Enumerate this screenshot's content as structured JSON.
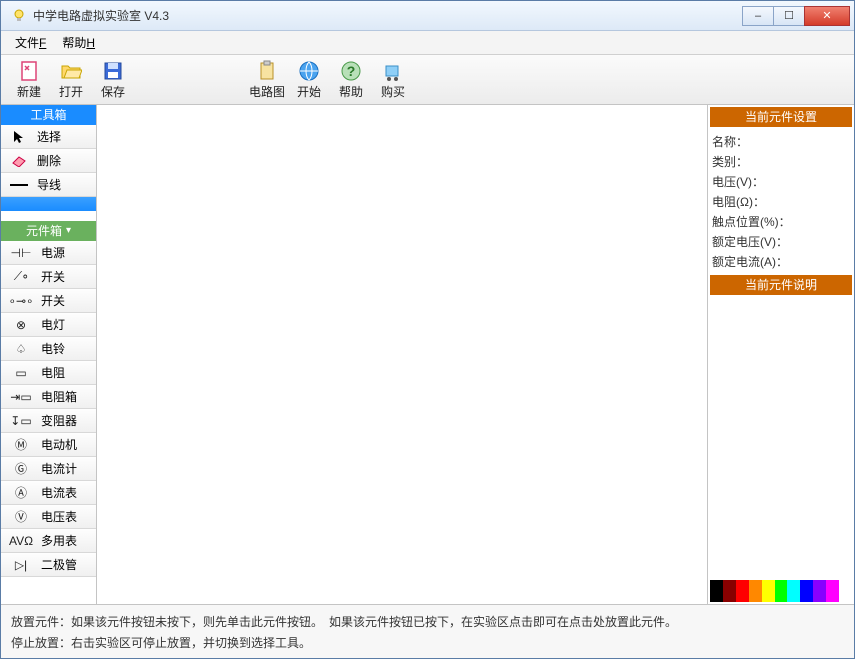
{
  "app": {
    "title": "中学电路虚拟实验室 V4.3"
  },
  "window_controls": {
    "minimize": "–",
    "maximize": "☐",
    "close": "✕"
  },
  "menubar": {
    "file": "文件",
    "file_key": "F",
    "help": "帮助",
    "help_key": "H"
  },
  "toolbar": {
    "new": "新建",
    "open": "打开",
    "save": "保存",
    "circuit": "电路图",
    "start": "开始",
    "help": "帮助",
    "buy": "购买"
  },
  "left": {
    "toolbox_title": "工具箱",
    "select": "选择",
    "delete": "删除",
    "wire": "导线",
    "componentbox_title": "元件箱",
    "components": [
      {
        "sym": "⊣⊢",
        "label": "电源"
      },
      {
        "sym": "⟋∘",
        "label": "开关"
      },
      {
        "sym": "∘⊸∘",
        "label": "开关"
      },
      {
        "sym": "⊗",
        "label": "电灯"
      },
      {
        "sym": "♤",
        "label": "电铃"
      },
      {
        "sym": "▭",
        "label": "电阻"
      },
      {
        "sym": "⇥▭",
        "label": "电阻箱"
      },
      {
        "sym": "↧▭",
        "label": "变阻器"
      },
      {
        "sym": "Ⓜ",
        "label": "电动机"
      },
      {
        "sym": "Ⓖ",
        "label": "电流计"
      },
      {
        "sym": "Ⓐ",
        "label": "电流表"
      },
      {
        "sym": "Ⓥ",
        "label": "电压表"
      },
      {
        "sym": "AVΩ",
        "label": "多用表"
      },
      {
        "sym": "▷|",
        "label": "二极管"
      }
    ]
  },
  "right": {
    "settings_title": "当前元件设置",
    "props": [
      "名称：",
      "类别：",
      "电压(V)：",
      "电阻(Ω)：",
      "触点位置(%)：",
      "额定电压(V)：",
      "额定电流(A)："
    ],
    "desc_title": "当前元件说明",
    "spectrum": [
      "#000",
      "#800",
      "#f00",
      "#f80",
      "#ff0",
      "#0f0",
      "#0ff",
      "#00f",
      "#80f",
      "#f0f",
      "#fff"
    ]
  },
  "help": {
    "line1_k": "放置元件：",
    "line1_v": "如果该元件按钮未按下，则先单击此元件按钮。　如果该元件按钮已按下，在实验区点击即可在点击处放置此元件。",
    "line2_k": "停止放置：",
    "line2_v": "右击实验区可停止放置，并切换到选择工具。"
  }
}
